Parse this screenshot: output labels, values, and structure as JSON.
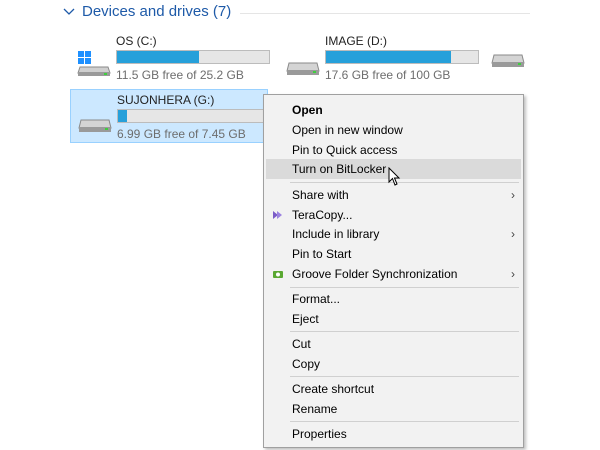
{
  "group": {
    "title": "Devices and drives (7)"
  },
  "drives": [
    {
      "name": "OS (C:)",
      "free_text": "11.5 GB free of 25.2 GB",
      "used_fraction": 0.54,
      "icon": "windows-drive-icon"
    },
    {
      "name": "IMAGE (D:)",
      "free_text": "17.6 GB free of 100 GB",
      "used_fraction": 0.82,
      "icon": "hard-drive-icon"
    },
    {
      "name": "SUJONHERA (G:)",
      "free_text": "6.99 GB free of 7.45 GB",
      "used_fraction": 0.06,
      "icon": "usb-drive-icon",
      "selected": true
    }
  ],
  "context_menu": {
    "items": [
      {
        "label": "Open",
        "bold": true
      },
      {
        "label": "Open in new window"
      },
      {
        "label": "Pin to Quick access"
      },
      {
        "label": "Turn on BitLocker",
        "highlighted": true
      },
      {
        "label": "Share with",
        "submenu": true
      },
      {
        "label": "TeraCopy...",
        "icon": "teracopy-icon"
      },
      {
        "label": "Include in library",
        "submenu": true
      },
      {
        "label": "Pin to Start"
      },
      {
        "label": "Groove Folder Synchronization",
        "icon": "groove-sync-icon",
        "submenu": true
      },
      {
        "label": "Format..."
      },
      {
        "label": "Eject"
      },
      {
        "label": "Cut"
      },
      {
        "label": "Copy"
      },
      {
        "label": "Create shortcut"
      },
      {
        "label": "Rename"
      },
      {
        "label": "Properties"
      }
    ]
  },
  "colors": {
    "accent": "#26a0da",
    "selection_bg": "#cce8ff",
    "header": "#1e5aa8",
    "menu_bg": "#f2f2f2",
    "menu_highlight": "#dadada"
  }
}
